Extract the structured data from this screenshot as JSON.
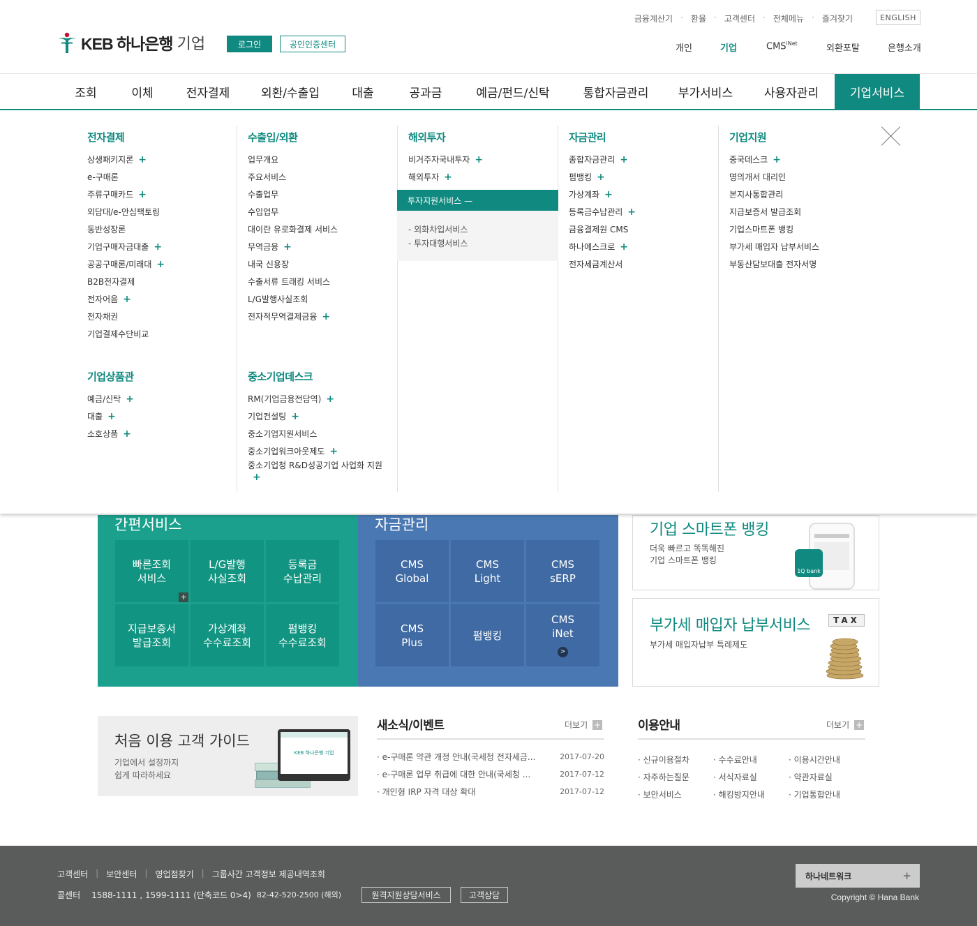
{
  "header": {
    "logo_text": "KEB 하나은행",
    "logo_sub": "기업",
    "login_label": "로그인",
    "cert_label": "공인인증센터",
    "utility": [
      "금융계산기",
      "환율",
      "고객센터",
      "전체메뉴",
      "즐겨찾기"
    ],
    "english_label": "ENGLISH",
    "site_nav": [
      {
        "label": "개인"
      },
      {
        "label": "기업"
      },
      {
        "label": "CMS",
        "sup": "iNet"
      },
      {
        "label": "외환포탈"
      },
      {
        "label": "은행소개"
      }
    ]
  },
  "gnb": [
    "조회",
    "이체",
    "전자결제",
    "외환/수출입",
    "대출",
    "공과금",
    "예금/펀드/신탁",
    "통합자금관리",
    "부가서비스",
    "사용자관리",
    "기업서비스"
  ],
  "mega": {
    "col1": {
      "title": "전자결제",
      "items": [
        {
          "label": "상생패키지론",
          "plus": "+"
        },
        {
          "label": "e-구매론"
        },
        {
          "label": "주류구매카드",
          "plus": "+"
        },
        {
          "label": "외담대/e-안심팩토링"
        },
        {
          "label": "동반성장론"
        },
        {
          "label": "기업구매자금대출",
          "plus": "+"
        },
        {
          "label": "공공구매론/미래대",
          "plus": "+"
        },
        {
          "label": "B2B전자결제"
        },
        {
          "label": "전자어음",
          "plus": "+"
        },
        {
          "label": "전자채권"
        },
        {
          "label": "기업결제수단비교"
        }
      ],
      "title2": "기업상품관",
      "items2": [
        {
          "label": "예금/신탁",
          "plus": "+"
        },
        {
          "label": "대출",
          "plus": "+"
        },
        {
          "label": "소호상품",
          "plus": "+"
        }
      ]
    },
    "col2": {
      "title": "수출입/외환",
      "items": [
        {
          "label": "업무개요"
        },
        {
          "label": "주요서비스"
        },
        {
          "label": "수출업무"
        },
        {
          "label": "수입업무"
        },
        {
          "label": "대이란 유로화결제 서비스"
        },
        {
          "label": "무역금융",
          "plus": "+"
        },
        {
          "label": "내국 신용장"
        },
        {
          "label": "수출서류 트래킹 서비스"
        },
        {
          "label": "L/G발행사실조회"
        },
        {
          "label": "전자적무역결제금융",
          "plus": "+"
        }
      ],
      "title2": "중소기업데스크",
      "items2": [
        {
          "label": "RM(기업금융전담역)",
          "plus": "+"
        },
        {
          "label": "기업컨설팅",
          "plus": "+"
        },
        {
          "label": "중소기업지원서비스"
        },
        {
          "label": "중소기업워크아웃제도",
          "plus": "+"
        },
        {
          "label": "중소기업청 R&D성공기업 사업화 지원",
          "plus": "+"
        }
      ]
    },
    "col3": {
      "title": "해외투자",
      "items": [
        {
          "label": "비거주자국내투자",
          "plus": "+"
        },
        {
          "label": "해외투자",
          "plus": "+"
        }
      ],
      "active": "투자지원서비스 —",
      "sub": [
        "- 외화차입서비스",
        "- 투자대행서비스"
      ]
    },
    "col4": {
      "title": "자금관리",
      "items": [
        {
          "label": "종합자금관리",
          "plus": "+"
        },
        {
          "label": "펌뱅킹",
          "plus": "+"
        },
        {
          "label": "가상계좌",
          "plus": "+"
        },
        {
          "label": "등록금수납관리",
          "plus": "+"
        },
        {
          "label": "금융결제원 CMS"
        },
        {
          "label": "하나에스크로",
          "plus": "+"
        },
        {
          "label": "전자세금계산서"
        }
      ]
    },
    "col5": {
      "title": "기업지원",
      "items": [
        {
          "label": "중국데스크",
          "plus": "+"
        },
        {
          "label": "명의개서 대리인"
        },
        {
          "label": "본지사통합관리"
        },
        {
          "label": "지급보증서 발급조회"
        },
        {
          "label": "기업스마트폰 뱅킹"
        },
        {
          "label": "부가세 매입자 납부서비스"
        },
        {
          "label": "부동산담보대출 전자서명"
        }
      ]
    }
  },
  "quick": {
    "title": "간편서비스",
    "tiles": [
      "빠른조회\n서비스",
      "L/G발행\n사실조회",
      "등록금\n수납관리",
      "지급보증서\n발급조회",
      "가상계좌\n수수료조회",
      "펌뱅킹\n수수료조회"
    ],
    "plus": "+"
  },
  "cms": {
    "title": "자금관리",
    "tiles": [
      "CMS\nGlobal",
      "CMS\nLight",
      "CMS\nsERP",
      "CMS\nPlus",
      "펌뱅킹",
      "CMS\niNet"
    ],
    "arrow": ">"
  },
  "banners": [
    {
      "title": "기업 스마트폰 뱅킹",
      "desc": "더욱 빠르고 똑똑해진\n기업 스마트폰 뱅킹",
      "badge": "1Q bank"
    },
    {
      "title": "부가세 매입자 납부서비스",
      "desc": "부가세 매입자납부 특례제도",
      "tax": "TAX"
    }
  ],
  "guide": {
    "title": "처음 이용 고객 가이드",
    "desc": "기업에서 설정까지\n쉽게 따라하세요",
    "screen_logo": "KEB 하나은행 기업"
  },
  "news": {
    "title": "새소식/이벤트",
    "more": "더보기",
    "items": [
      {
        "title": "e-구매론 약관 개정 안내(국세청 전자세금...",
        "date": "2017-07-20"
      },
      {
        "title": "e-구매론 업무 취급에 대한 안내(국세청 ...",
        "date": "2017-07-12"
      },
      {
        "title": "개인형 IRP 자격 대상 확대",
        "date": "2017-07-12"
      }
    ]
  },
  "info": {
    "title": "이용안내",
    "more": "더보기",
    "items": [
      "신규이용절차",
      "수수료안내",
      "이용시간안내",
      "자주하는질문",
      "서식자료실",
      "약관자료실",
      "보안서비스",
      "해킹방지안내",
      "기업통합안내"
    ]
  },
  "footer": {
    "links": [
      "고객센터",
      "보안센터",
      "영업점찾기",
      "그룹사간 고객정보 제공내역조회"
    ],
    "call_label": "콜센터",
    "call_numbers": "1588-1111 , 1599-1111 (단축코드 0>4)",
    "overseas": "82-42-520-2500 (해외)",
    "remote_btn": "원격지원상담서비스",
    "consult_btn": "고객상담",
    "hana_network": "하나네트워크",
    "hana_plus": "+",
    "copyright": "Copyright © Hana Bank"
  },
  "colors": {
    "primary": "#108a80",
    "quick_bg": "#1aa08c",
    "cms_bg": "#4a78b2",
    "footer_bg": "#595c5a"
  }
}
